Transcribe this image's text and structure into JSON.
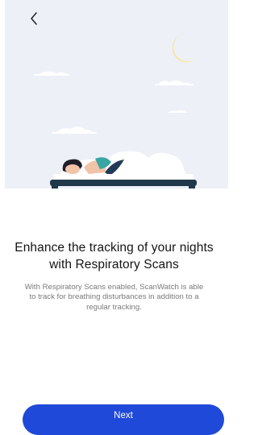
{
  "header": {
    "back_icon": "chevron-left-icon"
  },
  "illustration": {
    "subject": "person-sleeping-in-bed",
    "icons": [
      "crescent-moon-icon",
      "cloud-icon",
      "bed-icon"
    ],
    "colors": {
      "background": "#eef0f8",
      "moon": "#f6e795",
      "bed_frame": "#21384b",
      "blanket": "#ffffff",
      "wristband": "#3aa6a3",
      "hair": "#1f1f2a"
    }
  },
  "content": {
    "title": "Enhance the tracking of your nights with Respiratory Scans",
    "description": "With Respiratory Scans enabled, ScanWatch is able to track for breathing disturbances in addition to a regular tracking."
  },
  "footer": {
    "next_label": "Next"
  },
  "colors": {
    "primary": "#1f49d8",
    "title_text": "#141414",
    "body_text": "#7a7a7a"
  }
}
